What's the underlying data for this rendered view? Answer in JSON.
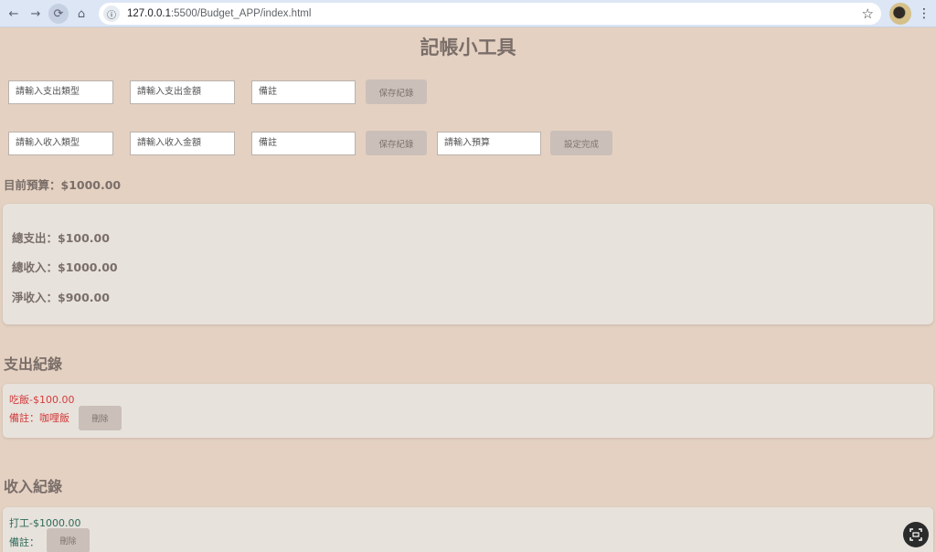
{
  "browser": {
    "url_host": "127.0.0.1",
    "url_rest": ":5500/Budget_APP/index.html",
    "back_icon": "←",
    "forward_icon": "→",
    "reload_icon": "⟳",
    "home_icon": "⌂",
    "info_icon": "ⓘ",
    "star_icon": "☆",
    "menu_icon": "⋮"
  },
  "page": {
    "title": "記帳小工具"
  },
  "expense_form": {
    "type_placeholder": "請輸入支出類型",
    "amount_placeholder": "請輸入支出金額",
    "note_placeholder": "備註",
    "save_label": "保存紀錄"
  },
  "income_form": {
    "type_placeholder": "請輸入收入類型",
    "amount_placeholder": "請輸入收入金額",
    "note_placeholder": "備註",
    "save_label": "保存紀錄"
  },
  "budget_form": {
    "placeholder": "請輸入預算",
    "set_label": "設定完成"
  },
  "budget_text": "目前預算：$1000.00",
  "summary": {
    "total_expense": "總支出：$100.00",
    "total_income": "總收入：$1000.00",
    "net_income": "淨收入：$900.00"
  },
  "expense_section": {
    "title": "支出紀錄",
    "records": [
      {
        "line1": "吃飯-$100.00",
        "line2": "備註：咖哩飯",
        "delete_label": "刪除"
      }
    ]
  },
  "income_section": {
    "title": "收入紀錄",
    "records": [
      {
        "line1": "打工-$1000.00",
        "line2": "備註：",
        "delete_label": "刪除"
      }
    ]
  },
  "colors": {
    "background": "#e4d1c2",
    "card": "#e8e2dc",
    "expense_text": "#d23c3c",
    "income_text": "#2d6b5a",
    "button": "#cbbfb9"
  }
}
